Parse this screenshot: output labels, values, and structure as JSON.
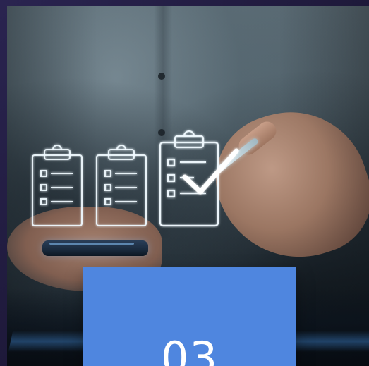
{
  "card": {
    "number": "03",
    "color": "#4f86df"
  },
  "icons": [
    {
      "name": "clipboard-icon",
      "state": "unchecked"
    },
    {
      "name": "clipboard-icon",
      "state": "unchecked"
    },
    {
      "name": "clipboard-check-icon",
      "state": "checked"
    }
  ]
}
